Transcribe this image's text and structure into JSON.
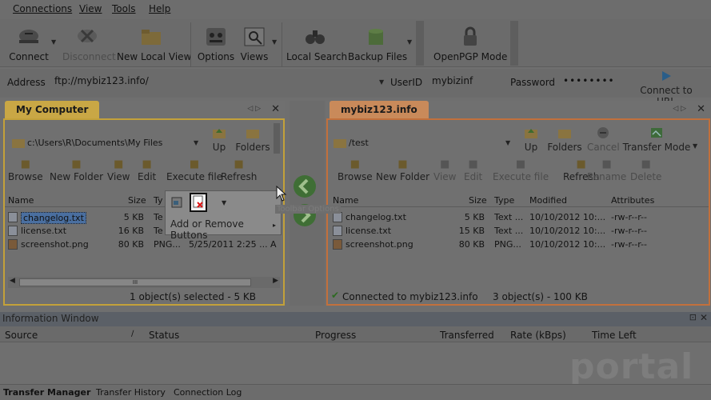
{
  "menu": [
    "Connections",
    "View",
    "Tools",
    "Help"
  ],
  "toolbar": {
    "connect": "Connect",
    "disconnect": "Disconnect",
    "new_local_view": "New Local View",
    "options": "Options",
    "views": "Views",
    "local_search": "Local Search",
    "backup_files": "Backup Files",
    "openpgp": "OpenPGP Mode"
  },
  "address": {
    "label": "Address",
    "value": "ftp://mybiz123.info/",
    "userid_label": "UserID",
    "userid": "mybizinf",
    "password_label": "Password",
    "password": "••••••••",
    "connect_url": "Connect to URL"
  },
  "left": {
    "tab": "My Computer",
    "path": "c:\\Users\\R\\Documents\\My Files",
    "up": "Up",
    "folders": "Folders",
    "tools": [
      "Browse",
      "New Folder",
      "View",
      "Edit",
      "Execute file",
      "Refresh"
    ],
    "columns": [
      "Name",
      "Size",
      "Ty"
    ],
    "files": [
      {
        "name": "changelog.txt",
        "size": "5 KB",
        "type": "Te"
      },
      {
        "name": "license.txt",
        "size": "16 KB",
        "type": "Te"
      },
      {
        "name": "screenshot.png",
        "size": "80 KB",
        "type": "PNG...",
        "date": "5/25/2011 2:25 ...",
        "attr": "A"
      }
    ],
    "status": "1 object(s) selected - 5 KB",
    "scroll_grip": "III"
  },
  "popup": {
    "label": "Add or Remove Buttons",
    "tooltip": "Toolbar Options"
  },
  "right": {
    "tab": "mybiz123.info",
    "path": "/test",
    "up": "Up",
    "folders": "Folders",
    "cancel": "Cancel",
    "transfer_mode": "Transfer Mode",
    "tools": [
      "Browse",
      "New Folder",
      "View",
      "Edit",
      "Execute file",
      "Refresh",
      "Rename",
      "Delete"
    ],
    "columns": [
      "Name",
      "Size",
      "Type",
      "Modified",
      "Attributes"
    ],
    "files": [
      {
        "name": "changelog.txt",
        "size": "5 KB",
        "type": "Text ...",
        "modified": "10/10/2012 10:...",
        "attr": "-rw-r--r--"
      },
      {
        "name": "license.txt",
        "size": "15 KB",
        "type": "Text ...",
        "modified": "10/10/2012 10:...",
        "attr": "-rw-r--r--"
      },
      {
        "name": "screenshot.png",
        "size": "80 KB",
        "type": "PNG...",
        "modified": "10/10/2012 10:...",
        "attr": "-rw-r--r--"
      }
    ],
    "status_conn": "Connected to mybiz123.info",
    "status_count": "3 object(s) - 100 KB"
  },
  "info": {
    "title": "Information Window",
    "columns": [
      "Source",
      "Status",
      "Progress",
      "Transferred",
      "Rate (kBps)",
      "Time Left"
    ]
  },
  "tabs": [
    "Transfer Manager",
    "Transfer History",
    "Connection Log"
  ],
  "watermark": "portal",
  "colors": {
    "left_accent": "#c3a13a",
    "right_accent": "#c2703c",
    "tab_left": "#c9a745",
    "tab_right": "#c98a5a"
  }
}
